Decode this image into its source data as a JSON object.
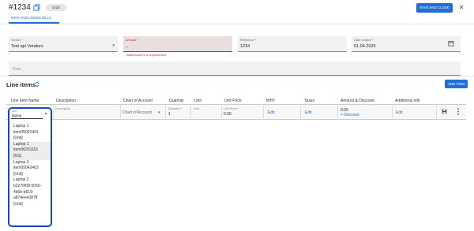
{
  "header": {
    "doc_title": "#1234",
    "status": "Draft",
    "save_close_label": "SAVE AND CLOSE"
  },
  "tabs": [
    {
      "label": "INFO AND LINKED BILLS"
    }
  ],
  "form": {
    "vendor": {
      "label": "Vendor",
      "required": "*",
      "value": "Test api Vendors"
    },
    "amount": {
      "label": "Amount",
      "required": "*",
      "value": "0",
      "error": "totalAmount is a required field"
    },
    "reference": {
      "label": "Reference",
      "required": "*",
      "value": "1234"
    },
    "date_created": {
      "label": "Date created",
      "required": "*",
      "value": "01.04.2025"
    },
    "note": {
      "placeholder": "Note"
    }
  },
  "line_items": {
    "title": "Line items",
    "add_label": "ADD ITEM",
    "columns": [
      "Line Item Name",
      "Description",
      "Chart of Account",
      "Quantity",
      "Unit",
      "Unit Price",
      "WHT",
      "Taxes",
      "Amount & Discount",
      "Additional Info"
    ],
    "row": {
      "item_label": "Item",
      "description_label": "Description",
      "coa_value": "Chart of Account",
      "quantity_label": "Quantity",
      "quantity_required": "*",
      "quantity_value": "1",
      "unit_label": "Unit",
      "unit_price_label": "Unit Price",
      "unit_price_required": "*",
      "unit_price_value": "0.00",
      "wht_link": "Edit",
      "taxes_link": "Edit",
      "amount_value": "0.00",
      "discount_link": "+ Discount",
      "additional_link": "Edit"
    },
    "dropdown": {
      "search_label": "Item",
      "search_value": "laptop",
      "options": [
        {
          "l1": "Laptop 1",
          "l2": "item05042401",
          "l3": "[Unit]",
          "l4": ""
        },
        {
          "l1": "Laptop 1",
          "l2": "item06201116",
          "l3": "[KG]",
          "l4": ""
        },
        {
          "l1": "Laptop 2",
          "l2": "item05042403",
          "l3": "[Unit]",
          "l4": ""
        },
        {
          "l1": "Laptop 2",
          "l2": "b2276f08-5056-",
          "l3": "4b6b-b619-",
          "l4": "a874ee4387ff"
        }
      ],
      "last_unit": "[Unit]"
    }
  },
  "colors": {
    "accent": "#1e6fd9",
    "error": "#c62828",
    "focus": "#1747b8"
  }
}
